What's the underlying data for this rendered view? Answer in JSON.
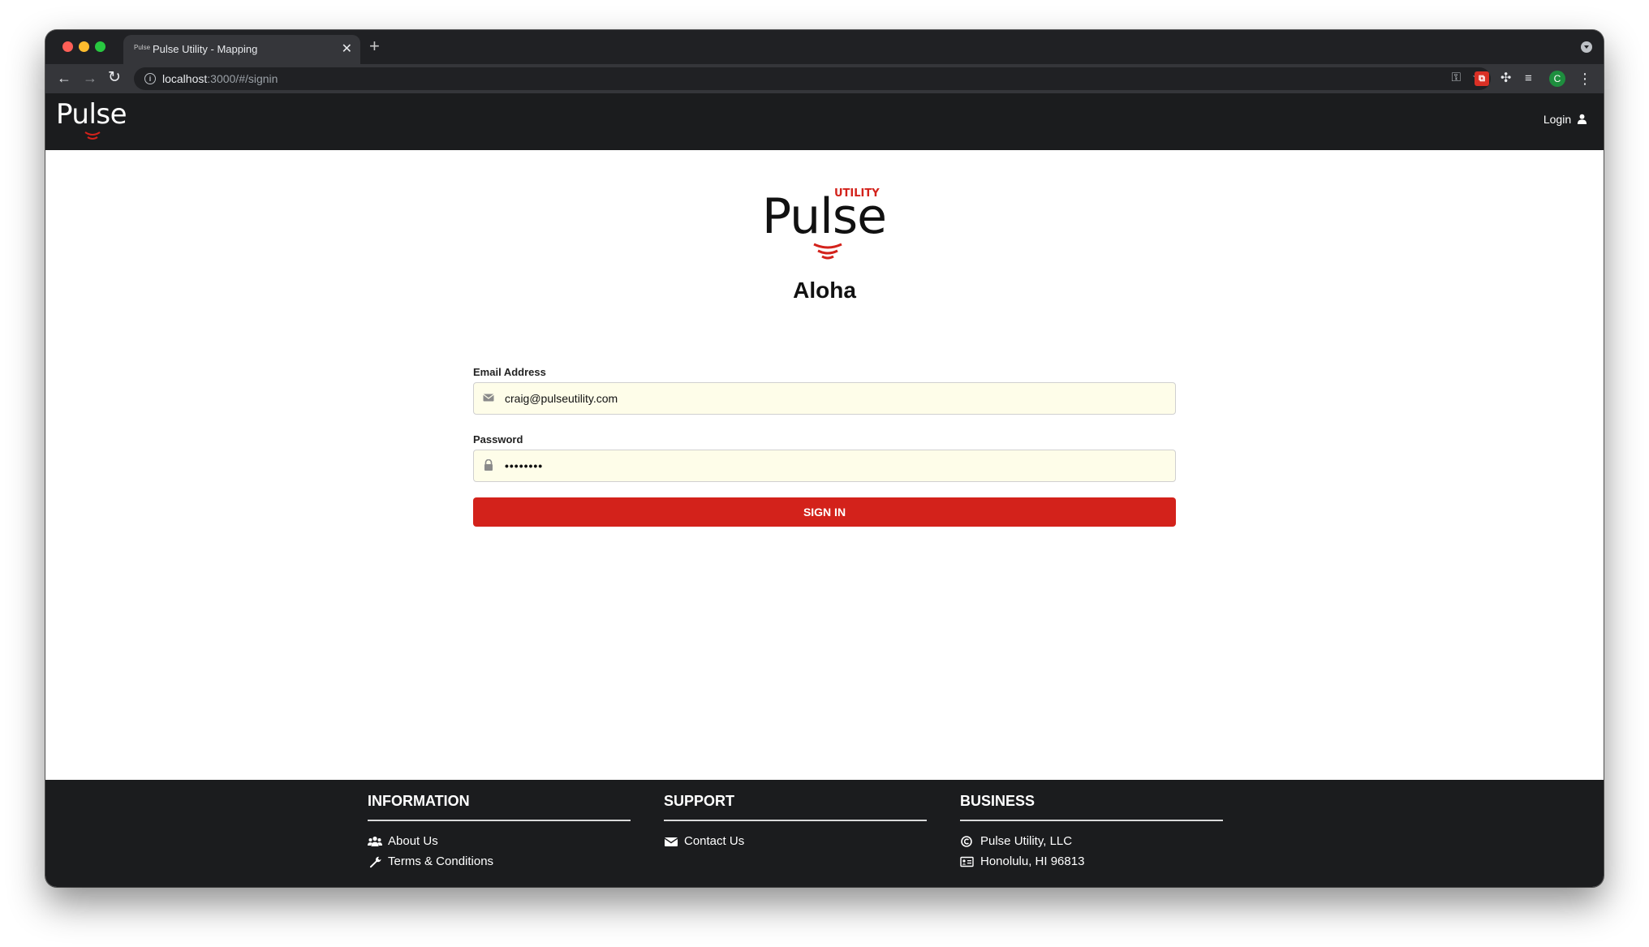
{
  "browser": {
    "tab_title": "Pulse Utility - Mapping",
    "tab_favicon_text": "Pulse",
    "url_host": "localhost",
    "url_rest": ":3000/#/signin",
    "profile_initial": "C"
  },
  "navbar": {
    "logo_text": "Pulse",
    "login_label": "Login"
  },
  "hero": {
    "logo_text": "Pulse",
    "logo_tagline": "UTILITY",
    "heading": "Aloha"
  },
  "form": {
    "email_label": "Email Address",
    "email_value": "craig@pulseutility.com",
    "password_label": "Password",
    "password_mask": "••••••••",
    "submit_label": "SIGN IN"
  },
  "footer": {
    "information": {
      "heading": "INFORMATION",
      "items": [
        "About Us",
        "Terms & Conditions"
      ]
    },
    "support": {
      "heading": "SUPPORT",
      "items": [
        "Contact Us"
      ]
    },
    "business": {
      "heading": "BUSINESS",
      "items": [
        "Pulse Utility, LLC",
        "Honolulu, HI 96813"
      ]
    }
  },
  "colors": {
    "brand_red": "#d3221b",
    "nav_bg": "#1b1c1e",
    "field_bg": "#fefde9"
  }
}
